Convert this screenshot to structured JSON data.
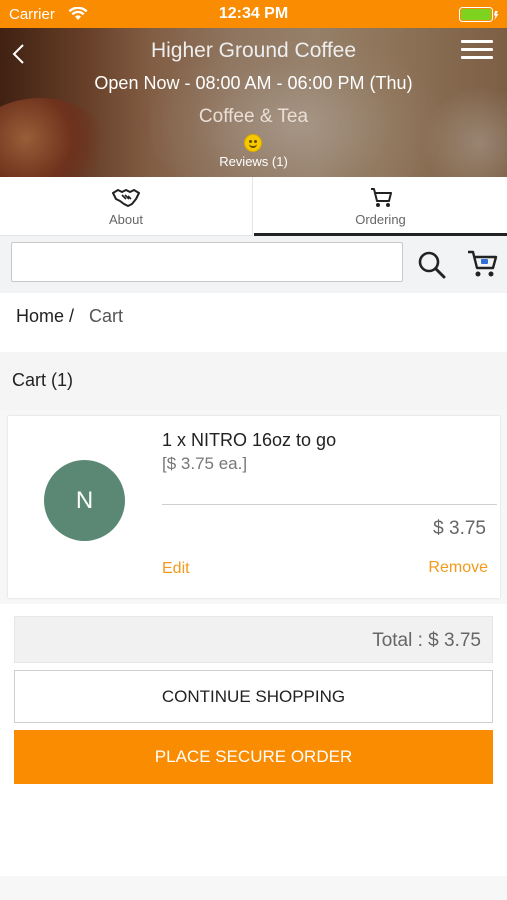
{
  "status_bar": {
    "carrier": "Carrier",
    "time": "12:34 PM",
    "battery_color": "#7ed321"
  },
  "header": {
    "store_name": "Higher Ground Coffee",
    "hours": "Open Now - 08:00 AM - 06:00 PM (Thu)",
    "category": "Coffee & Tea",
    "reviews": "Reviews (1)",
    "accent_color": "#f98c00"
  },
  "tabs": [
    {
      "label": "About",
      "icon": "handshake-icon",
      "active": false
    },
    {
      "label": "Ordering",
      "icon": "cart-icon",
      "active": true
    }
  ],
  "search": {
    "value": "",
    "placeholder": ""
  },
  "breadcrumb": {
    "home": "Home /",
    "current": "Cart"
  },
  "cart": {
    "title": "Cart (1)",
    "items": [
      {
        "avatar_letter": "N",
        "avatar_color": "#5a8874",
        "name": "1 x NITRO 16oz to go",
        "price_each": "[$ 3.75 ea.]",
        "line_total": "$ 3.75",
        "edit_label": "Edit",
        "remove_label": "Remove"
      }
    ],
    "total": "Total : $ 3.75",
    "continue_label": "CONTINUE SHOPPING",
    "place_order_label": "PLACE SECURE ORDER"
  }
}
